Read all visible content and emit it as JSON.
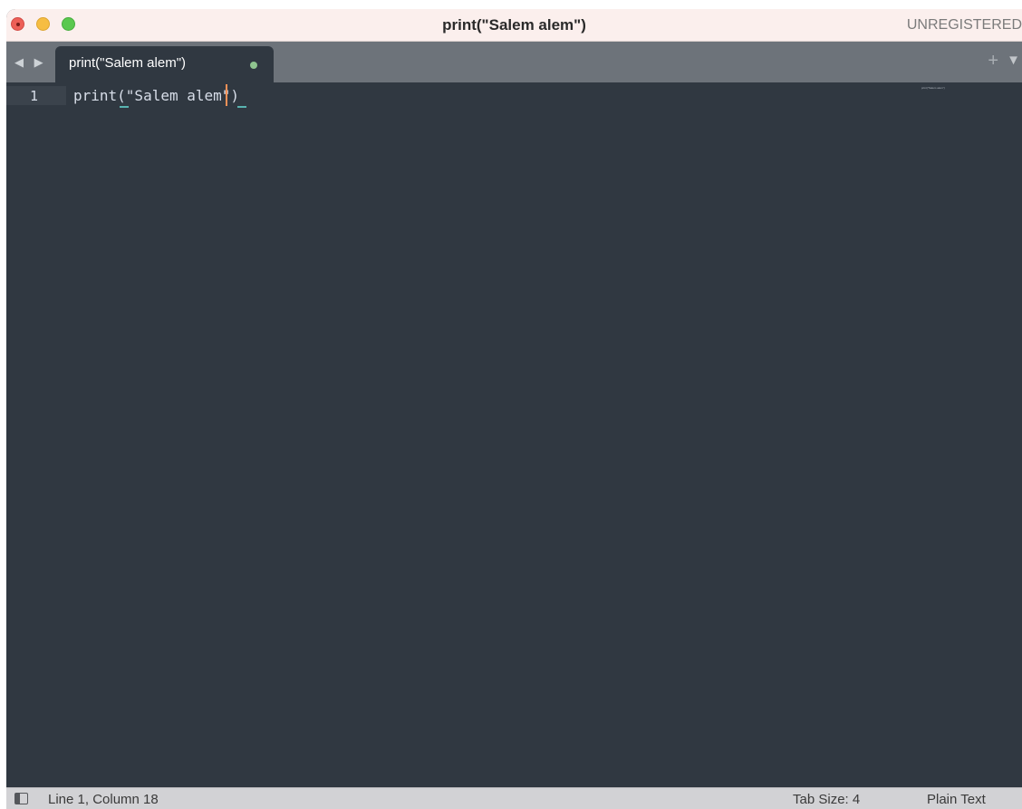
{
  "window": {
    "title": "print(\"Salem alem\")",
    "registration": "UNREGISTERED"
  },
  "tabs": {
    "nav": "◀ ▶",
    "items": [
      {
        "label": "print(\"Salem alem\")",
        "modified": true
      }
    ],
    "new_tab": "+",
    "menu": "▼"
  },
  "editor": {
    "line_numbers": [
      "1"
    ],
    "lines": [
      "print(\"Salem alem\")"
    ],
    "minimap_text": "print(\"Salem alem\")"
  },
  "status": {
    "position": "Line 1, Column 18",
    "tab_size": "Tab Size: 4",
    "syntax": "Plain Text"
  },
  "colors": {
    "editor_background": "#303841",
    "caret": "#f99157",
    "bracket_match": "#59b3b0",
    "modified_dot": "#8fc48f"
  }
}
